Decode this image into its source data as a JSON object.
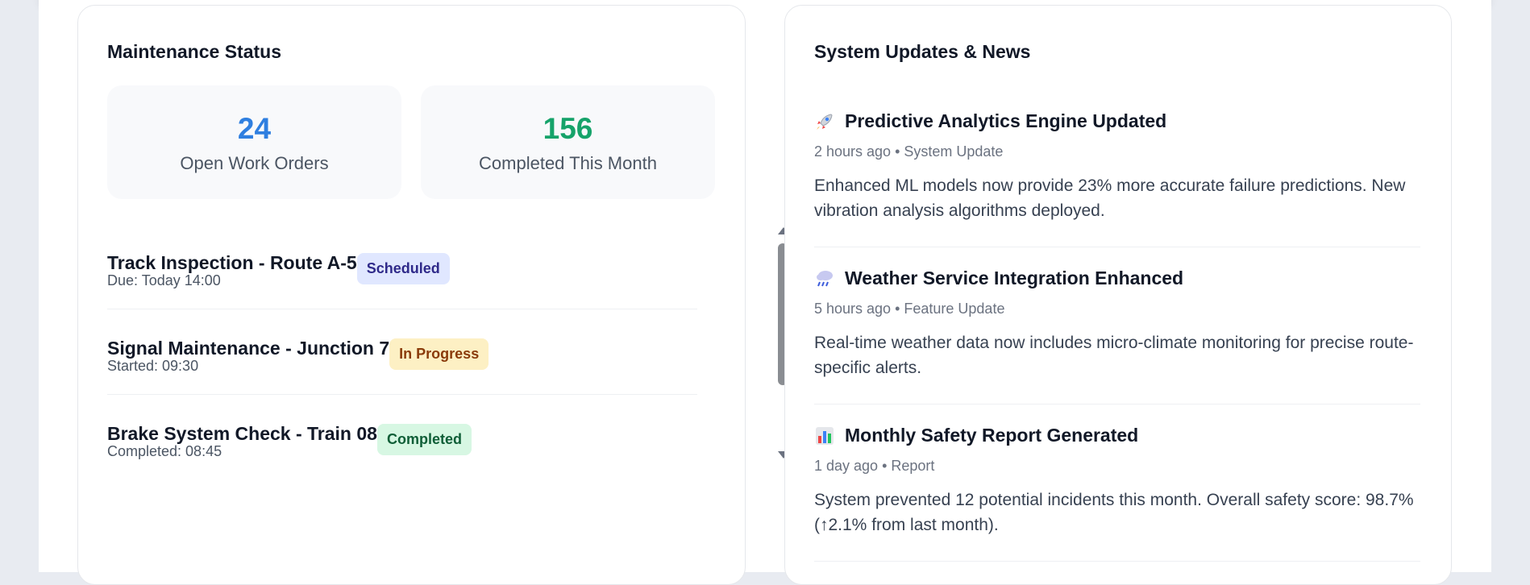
{
  "maintenance": {
    "title": "Maintenance Status",
    "stats": [
      {
        "value": "24",
        "label": "Open Work Orders",
        "color": "#2f7fe0"
      },
      {
        "value": "156",
        "label": "Completed This Month",
        "color": "#16a36a"
      }
    ],
    "items": [
      {
        "title": "Track Inspection - Route A-5",
        "badge": "Scheduled",
        "sub": "Due: Today 14:00",
        "badge_bg": "#e0e7ff",
        "badge_fg": "#2f2a8a"
      },
      {
        "title": "Signal Maintenance - Junction 7",
        "badge": "In Progress",
        "sub": "Started: 09:30",
        "badge_bg": "#fdf0c4",
        "badge_fg": "#8a3b0a"
      },
      {
        "title": "Brake System Check - Train 08",
        "badge": "Completed",
        "sub": "Completed: 08:45",
        "badge_bg": "#d7f7e3",
        "badge_fg": "#0f5e37"
      }
    ]
  },
  "news": {
    "title": "System Updates & News",
    "items": [
      {
        "icon": "rocket-icon",
        "title": "Predictive Analytics Engine Updated",
        "meta": "2 hours ago • System Update",
        "body": "Enhanced ML models now provide 23% more accurate failure predictions. New vibration analysis algorithms deployed."
      },
      {
        "icon": "cloud-rain-icon",
        "title": "Weather Service Integration Enhanced",
        "meta": "5 hours ago • Feature Update",
        "body": "Real-time weather data now includes micro-climate monitoring for precise route-specific alerts."
      },
      {
        "icon": "bar-chart-icon",
        "title": "Monthly Safety Report Generated",
        "meta": "1 day ago • Report",
        "body": "System prevented 12 potential incidents this month. Overall safety score: 98.7% (↑2.1% from last month)."
      }
    ]
  }
}
